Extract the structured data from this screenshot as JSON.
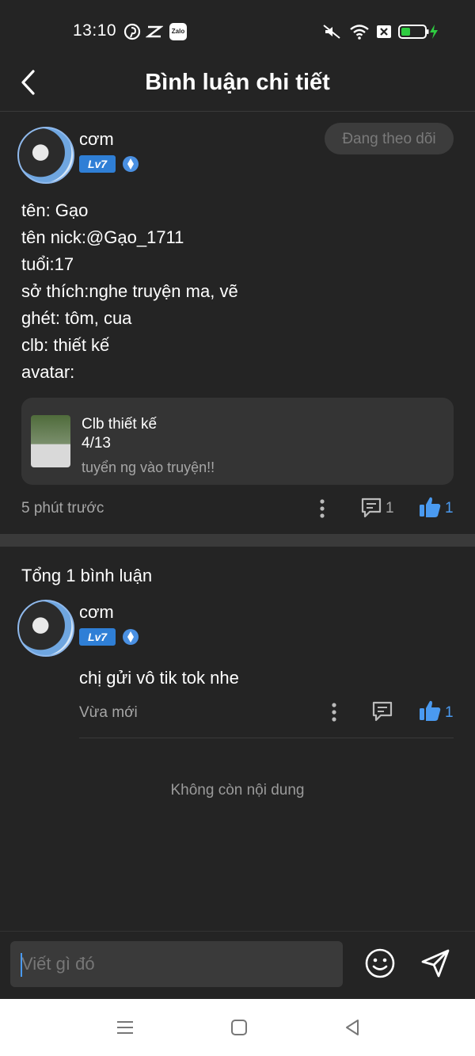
{
  "status_bar": {
    "time": "13:10",
    "icons": [
      "pinterest-icon",
      "capcut-icon",
      "zalo-icon",
      "mute-icon",
      "wifi-icon",
      "close-box-icon",
      "battery-icon",
      "charging-icon"
    ],
    "zalo_label": "Zalo"
  },
  "header": {
    "title": "Bình luận chi tiết"
  },
  "post": {
    "username": "cơm",
    "level": "Lv7",
    "follow_label": "Đang theo dõi",
    "lines": [
      "tên: Gạo",
      "tên nick:@Gạo_1711",
      "tuổi:17",
      "sở thích:nghe truyện ma, vẽ",
      "ghét: tôm, cua",
      "clb: thiết kế",
      "avatar:"
    ],
    "card": {
      "title": "Clb thiết kế",
      "count": "4/13",
      "desc": "tuyển ng vào truyện!!"
    },
    "time": "5 phút trước",
    "comment_count": "1",
    "like_count": "1"
  },
  "comments_section": {
    "total": "Tổng 1 bình luận",
    "items": [
      {
        "username": "cơm",
        "level": "Lv7",
        "text": "chị gửi vô tik tok nhe",
        "time": "Vừa mới",
        "like_count": "1"
      }
    ],
    "end_text": "Không còn nội dung"
  },
  "input": {
    "placeholder": "Viết gì đó"
  },
  "colors": {
    "background": "#242424",
    "accent": "#4a9af0",
    "muted": "#a6a6a6",
    "badge": "#2f7fd6"
  }
}
